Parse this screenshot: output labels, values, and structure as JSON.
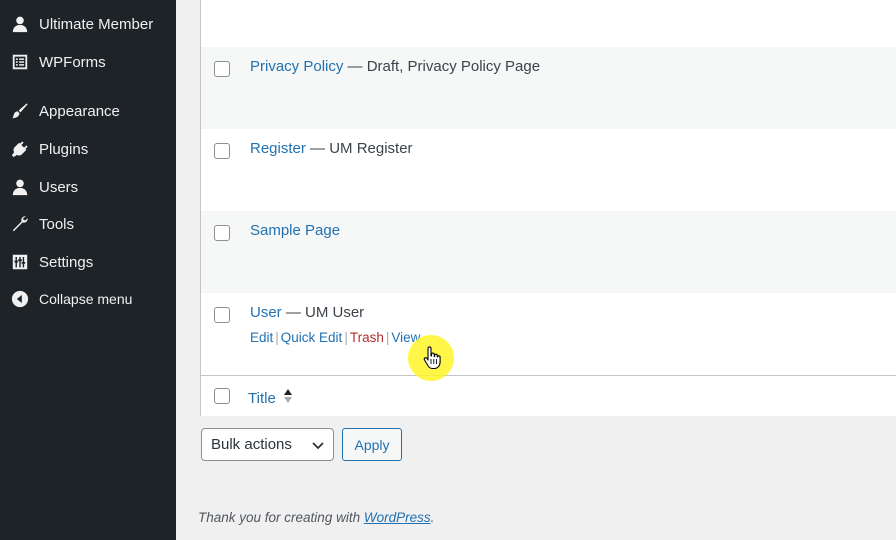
{
  "sidebar": {
    "items": [
      {
        "label": "Ultimate Member",
        "icon": "user-icon"
      },
      {
        "label": "WPForms",
        "icon": "form-icon"
      },
      {
        "label": "Appearance",
        "icon": "paintbrush-icon"
      },
      {
        "label": "Plugins",
        "icon": "plugin-icon"
      },
      {
        "label": "Users",
        "icon": "user-icon"
      },
      {
        "label": "Tools",
        "icon": "wrench-icon"
      },
      {
        "label": "Settings",
        "icon": "settings-icon"
      }
    ],
    "collapse_label": "Collapse menu"
  },
  "rows": [
    {
      "title": "Privacy Policy",
      "state": " — Draft, Privacy Policy Page"
    },
    {
      "title": "Register",
      "state": " — UM Register"
    },
    {
      "title": "Sample Page",
      "state": ""
    },
    {
      "title": "User",
      "state": " — UM User",
      "actions": {
        "edit": "Edit",
        "quick_edit": "Quick Edit",
        "trash": "Trash",
        "view": "View",
        "sep": "|"
      }
    }
  ],
  "footer_header": {
    "title": "Title"
  },
  "bulk": {
    "select_value": "Bulk actions",
    "apply": "Apply"
  },
  "footer": {
    "text": "Thank you for creating with ",
    "link": "WordPress",
    "period": "."
  },
  "colors": {
    "sidebar_bg": "#1d2327",
    "link": "#2271b1",
    "trash": "#b32d2e",
    "cursor_highlight": "#fff528"
  }
}
